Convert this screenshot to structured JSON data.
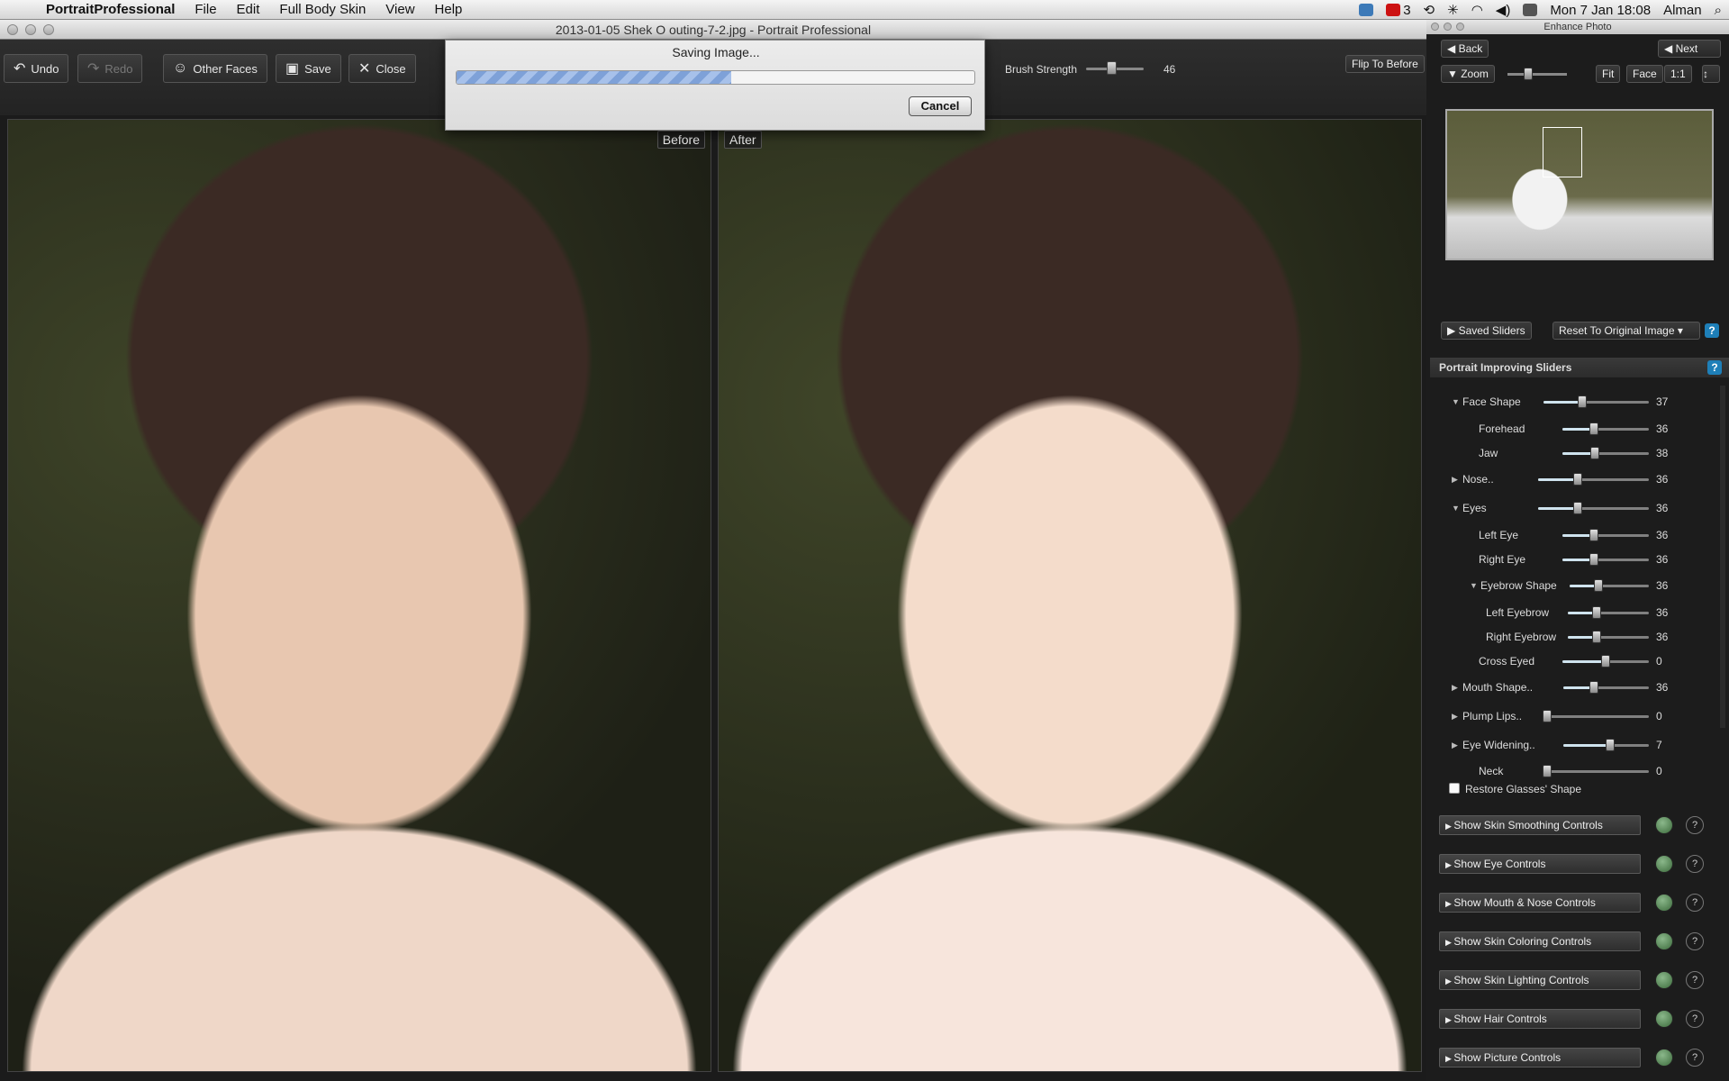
{
  "menubar": {
    "items": [
      "PortraitProfessional",
      "File",
      "Edit",
      "Full Body Skin",
      "View",
      "Help"
    ],
    "status": {
      "adobe_count": "3",
      "clock": "Mon 7 Jan 18:08",
      "user": "Alman"
    }
  },
  "window": {
    "title": "2013-01-05 Shek O outing-7-2.jpg - Portrait Professional"
  },
  "toolbar": {
    "undo": "Undo",
    "redo": "Redo",
    "other_faces": "Other Faces",
    "save": "Save",
    "close": "Close",
    "brush_label": "Brush Strength",
    "brush_value": "46",
    "brush_fraction": 0.46,
    "flip": "Flip To Before"
  },
  "dialog": {
    "title": "Saving Image...",
    "cancel": "Cancel",
    "progress": 0.53
  },
  "photos": {
    "before": "Before",
    "after": "After"
  },
  "panel": {
    "title": "Enhance Photo",
    "back": "Back",
    "next": "Next",
    "zoom": "Zoom",
    "fit": "Fit",
    "face": "Face",
    "one": "1:1",
    "saved": "Saved Sliders",
    "reset": "Reset To Original Image",
    "section": "Portrait Improving Sliders",
    "help": "?"
  },
  "sliders": [
    {
      "label": "Face Shape",
      "value": "37",
      "tri": "▼",
      "indent": 0,
      "fill": 0.37
    },
    {
      "label": "Forehead",
      "value": "36",
      "tri": "",
      "indent": 1,
      "fill": 0.36
    },
    {
      "label": "Jaw",
      "value": "38",
      "tri": "",
      "indent": 1,
      "fill": 0.38
    },
    {
      "label": "Nose..",
      "value": "36",
      "tri": "▶",
      "indent": 0,
      "fill": 0.36
    },
    {
      "label": "Eyes",
      "value": "36",
      "tri": "▼",
      "indent": 0,
      "fill": 0.36
    },
    {
      "label": "Left Eye",
      "value": "36",
      "tri": "",
      "indent": 1,
      "fill": 0.36
    },
    {
      "label": "Right Eye",
      "value": "36",
      "tri": "",
      "indent": 1,
      "fill": 0.36
    },
    {
      "label": "Eyebrow Shape",
      "value": "36",
      "tri": "▼",
      "indent": 2,
      "fill": 0.36
    },
    {
      "label": "Left Eyebrow",
      "value": "36",
      "tri": "",
      "indent": 3,
      "fill": 0.36
    },
    {
      "label": "Right Eyebrow",
      "value": "36",
      "tri": "",
      "indent": 3,
      "fill": 0.36
    },
    {
      "label": "Cross Eyed",
      "value": "0",
      "tri": "",
      "indent": 1,
      "fill": 0.5
    },
    {
      "label": "Mouth Shape..",
      "value": "36",
      "tri": "▶",
      "indent": 0,
      "fill": 0.36
    },
    {
      "label": "Plump Lips..",
      "value": "0",
      "tri": "▶",
      "indent": 0,
      "fill": 0.0
    },
    {
      "label": "Eye Widening..",
      "value": "7",
      "tri": "▶",
      "indent": 0,
      "fill": 0.55
    },
    {
      "label": "Neck",
      "value": "0",
      "tri": "",
      "indent": 1,
      "fill": 0.0
    }
  ],
  "restore_glasses": "Restore Glasses' Shape",
  "show_controls": [
    "Show Skin Smoothing Controls",
    "Show Eye Controls",
    "Show Mouth & Nose Controls",
    "Show Skin Coloring Controls",
    "Show Skin Lighting Controls",
    "Show Hair Controls",
    "Show Picture Controls"
  ]
}
